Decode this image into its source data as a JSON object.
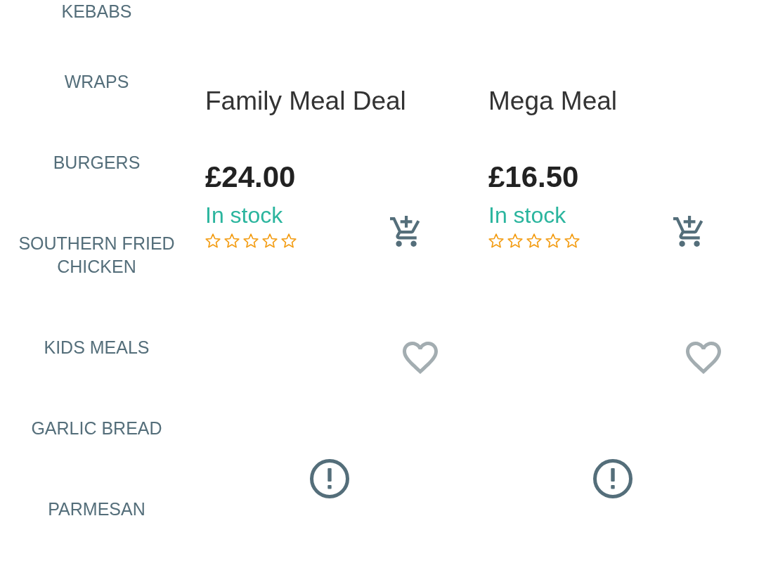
{
  "categories": [
    {
      "label": "KEBABS"
    },
    {
      "label": "WRAPS"
    },
    {
      "label": "BURGERS"
    },
    {
      "label": "SOUTHERN FRIED CHICKEN"
    },
    {
      "label": "KIDS MEALS"
    },
    {
      "label": "GARLIC BREAD"
    },
    {
      "label": "PARMESAN"
    }
  ],
  "products": [
    {
      "name": "Family Meal Deal",
      "price": "£24.00",
      "stock_status": "In stock",
      "stars": 0,
      "favorited": false
    },
    {
      "name": "Mega Meal",
      "price": "£16.50",
      "stock_status": "In stock",
      "stars": 0,
      "favorited": false
    }
  ]
}
